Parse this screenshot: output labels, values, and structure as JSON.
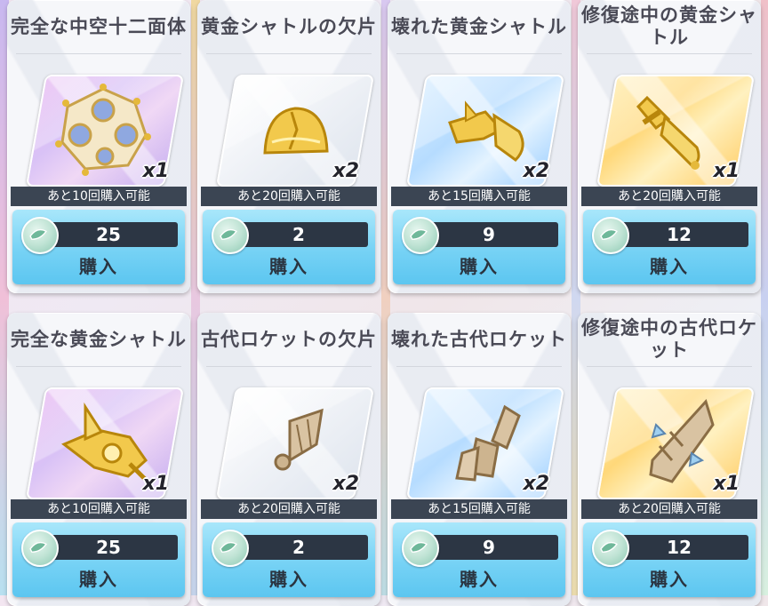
{
  "buy_label": "購入",
  "products": [
    {
      "name": "完全な中空十二面体",
      "quantity": "x1",
      "limit_text": "あと10回購入可能",
      "price": "25",
      "rarity": "purple",
      "item_icon": "hollow-dodecahedron-icon"
    },
    {
      "name": "黄金シャトルの欠片",
      "quantity": "x2",
      "limit_text": "あと20回購入可能",
      "price": "2",
      "rarity": "white",
      "item_icon": "golden-shuttle-fragment-icon"
    },
    {
      "name": "壊れた黄金シャトル",
      "quantity": "x2",
      "limit_text": "あと15回購入可能",
      "price": "9",
      "rarity": "blue",
      "item_icon": "broken-golden-shuttle-icon"
    },
    {
      "name": "修復途中の黄金シャトル",
      "quantity": "x1",
      "limit_text": "あと20回購入可能",
      "price": "12",
      "rarity": "gold",
      "item_icon": "repairing-golden-shuttle-icon"
    },
    {
      "name": "完全な黄金シャトル",
      "quantity": "x1",
      "limit_text": "あと10回購入可能",
      "price": "25",
      "rarity": "purple",
      "item_icon": "complete-golden-shuttle-icon"
    },
    {
      "name": "古代ロケットの欠片",
      "quantity": "x2",
      "limit_text": "あと20回購入可能",
      "price": "2",
      "rarity": "white",
      "item_icon": "ancient-rocket-fragment-icon"
    },
    {
      "name": "壊れた古代ロケット",
      "quantity": "x2",
      "limit_text": "あと15回購入可能",
      "price": "9",
      "rarity": "blue",
      "item_icon": "broken-ancient-rocket-icon"
    },
    {
      "name": "修復途中の古代ロケット",
      "quantity": "x1",
      "limit_text": "あと20回購入可能",
      "price": "12",
      "rarity": "gold",
      "item_icon": "repairing-ancient-rocket-icon"
    }
  ],
  "colors": {
    "gold_item": "#f2c94c",
    "bronze_item": "#d9c3a2",
    "price_bar": "#2c3644",
    "buy_button": "#76d2f5"
  }
}
